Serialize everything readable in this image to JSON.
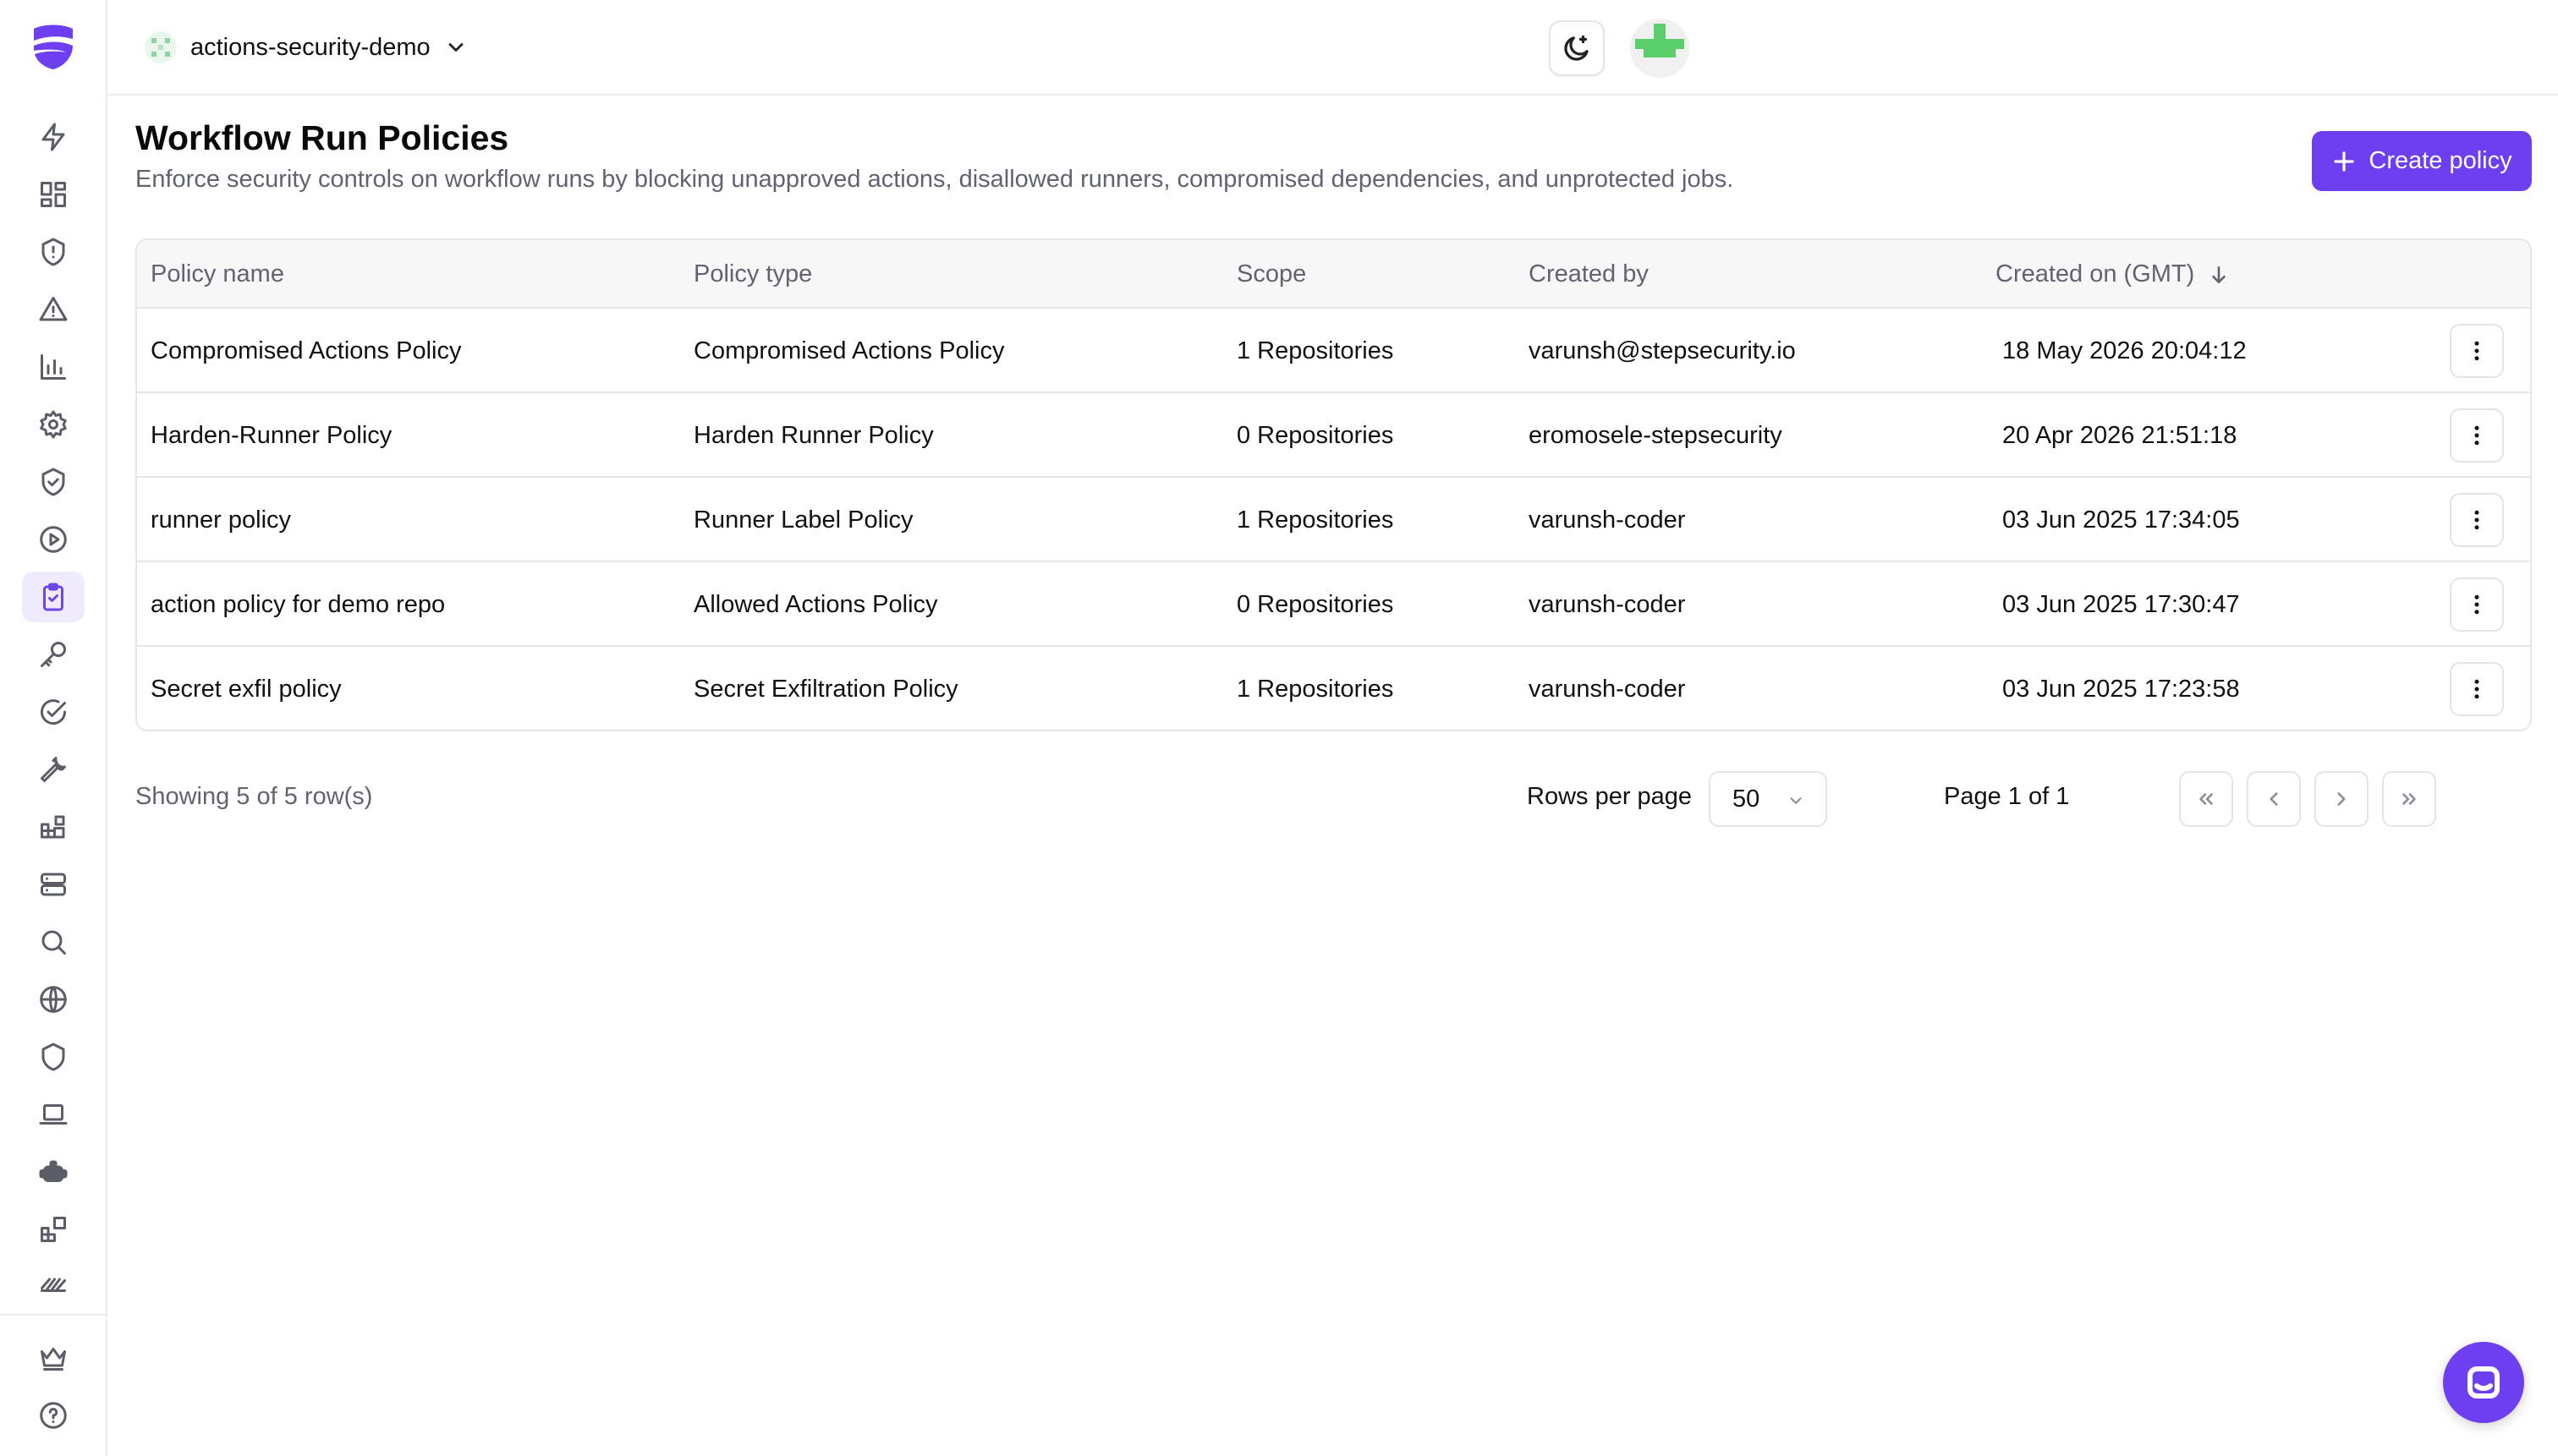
{
  "org": {
    "name": "actions-security-demo"
  },
  "page": {
    "title": "Workflow Run Policies",
    "subtitle": "Enforce security controls on workflow runs by blocking unapproved actions, disallowed runners, compromised dependencies, and unprotected jobs.",
    "create_label": "Create policy"
  },
  "colors": {
    "accent": "#6d3ff0",
    "active_nav_bg": "#efebfc",
    "border": "#e6e6ea",
    "muted_text": "#606370"
  },
  "sidebar": {
    "items": [
      {
        "icon": "lightning-icon",
        "active": false
      },
      {
        "icon": "dashboard-grid-icon",
        "active": false
      },
      {
        "icon": "shield-alert-icon",
        "active": false
      },
      {
        "icon": "warning-triangle-icon",
        "active": false
      },
      {
        "icon": "bar-chart-icon",
        "active": false
      },
      {
        "icon": "gear-icon",
        "active": false
      },
      {
        "icon": "shield-check-icon",
        "active": false
      },
      {
        "icon": "play-circle-icon",
        "active": false
      },
      {
        "icon": "clipboard-check-icon",
        "active": true
      },
      {
        "icon": "key-icon",
        "active": false
      },
      {
        "icon": "check-circle-icon",
        "active": false
      },
      {
        "icon": "wrench-icon",
        "active": false
      },
      {
        "icon": "blocks-icon",
        "active": false
      },
      {
        "icon": "server-icon",
        "active": false
      },
      {
        "icon": "search-icon",
        "active": false
      },
      {
        "icon": "globe-icon",
        "active": false
      },
      {
        "icon": "shield-icon",
        "active": false
      },
      {
        "icon": "laptop-icon",
        "active": false
      },
      {
        "icon": "robot-icon",
        "active": false
      },
      {
        "icon": "blocks-plus-icon",
        "active": false
      },
      {
        "icon": "stripes-icon",
        "active": false
      },
      {
        "icon": "crown-icon",
        "active": false
      },
      {
        "icon": "help-circle-icon",
        "active": false
      }
    ]
  },
  "table": {
    "headers": {
      "name": "Policy name",
      "type": "Policy type",
      "scope": "Scope",
      "created_by": "Created by",
      "created_on": "Created on (GMT)"
    },
    "rows": [
      {
        "name": "Compromised Actions Policy",
        "type": "Compromised Actions Policy",
        "scope": "1 Repositories",
        "created_by": "varunsh@stepsecurity.io",
        "created_on": "18 May 2026 20:04:12"
      },
      {
        "name": "Harden-Runner Policy",
        "type": "Harden Runner Policy",
        "scope": "0 Repositories",
        "created_by": "eromosele-stepsecurity",
        "created_on": "20 Apr 2026 21:51:18"
      },
      {
        "name": "runner policy",
        "type": "Runner Label Policy",
        "scope": "1 Repositories",
        "created_by": "varunsh-coder",
        "created_on": "03 Jun 2025 17:34:05"
      },
      {
        "name": "action policy for demo repo",
        "type": "Allowed Actions Policy",
        "scope": "0 Repositories",
        "created_by": "varunsh-coder",
        "created_on": "03 Jun 2025 17:30:47"
      },
      {
        "name": "Secret exfil policy",
        "type": "Secret Exfiltration Policy",
        "scope": "1 Repositories",
        "created_by": "varunsh-coder",
        "created_on": "03 Jun 2025 17:23:58"
      }
    ]
  },
  "pagination": {
    "showing": "Showing 5 of 5 row(s)",
    "rows_per_page_label": "Rows per page",
    "rows_per_page_value": "50",
    "page_info": "Page 1 of 1"
  }
}
